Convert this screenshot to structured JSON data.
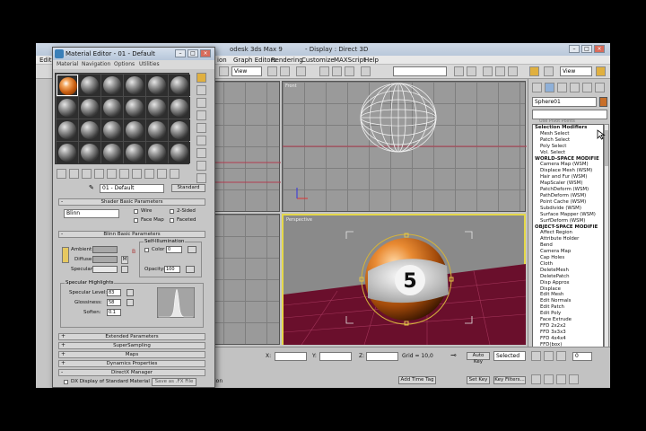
{
  "app": {
    "title_partial": "odesk 3ds Max 9",
    "display_mode": "- Display : Direct 3D"
  },
  "menu": [
    "Edit",
    "ion",
    "Graph Editors",
    "Rendering",
    "Customize",
    "MAXScript",
    "Help"
  ],
  "toolbar": {
    "view_combo": "View",
    "view_combo2": "View"
  },
  "viewports": {
    "front": "Front",
    "perspective": "Perspective",
    "ball_number": "5"
  },
  "command_panel": {
    "object_name": "Sphere01",
    "use_pivot": "Use Pivot Points",
    "modifiers": [
      {
        "t": "Selection Modifiers",
        "h": true
      },
      {
        "t": "Mesh Select"
      },
      {
        "t": "Patch Select"
      },
      {
        "t": "Poly Select"
      },
      {
        "t": "Vol. Select"
      },
      {
        "t": "WORLD-SPACE MODIFIE",
        "h": true
      },
      {
        "t": "Camera Map (WSM)"
      },
      {
        "t": "Displace Mesh (WSM)"
      },
      {
        "t": "Hair and Fur (WSM)"
      },
      {
        "t": "MapScaler (WSM)"
      },
      {
        "t": "PatchDeform (WSM)"
      },
      {
        "t": "PathDeform (WSM)"
      },
      {
        "t": "Point Cache (WSM)"
      },
      {
        "t": "Subdivide (WSM)"
      },
      {
        "t": "Surface Mapper (WSM)"
      },
      {
        "t": "SurfDeform (WSM)"
      },
      {
        "t": "OBJECT-SPACE MODIFIE",
        "h": true
      },
      {
        "t": "Affect Region"
      },
      {
        "t": "Attribute Holder"
      },
      {
        "t": "Bend"
      },
      {
        "t": "Camera Map"
      },
      {
        "t": "Cap Holes"
      },
      {
        "t": "Cloth"
      },
      {
        "t": "DeleteMesh"
      },
      {
        "t": "DeletePatch"
      },
      {
        "t": "Disp Approx"
      },
      {
        "t": "Displace"
      },
      {
        "t": "Edit Mesh"
      },
      {
        "t": "Edit Normals"
      },
      {
        "t": "Edit Patch"
      },
      {
        "t": "Edit Poly"
      },
      {
        "t": "Face Extrude"
      },
      {
        "t": "FFD 2x2x2"
      },
      {
        "t": "FFD 3x3x3"
      },
      {
        "t": "FFD 4x4x4"
      },
      {
        "t": "FFD(box)"
      },
      {
        "t": "FFD(cyl)"
      },
      {
        "t": "Flex"
      },
      {
        "t": "HSDS"
      },
      {
        "t": "Lattice"
      }
    ]
  },
  "bottom": {
    "x_label": "X:",
    "y_label": "Y:",
    "z_label": "Z:",
    "grid": "Grid = 10,0",
    "auto_key": "Auto Key",
    "selected": "Selected",
    "set_key": "Set Key",
    "key_filters": "Key Filters...",
    "add_time_tag": "Add Time Tag",
    "status": "ns the rotation",
    "frame": "0"
  },
  "material_editor": {
    "title": "Material Editor - 01 - Default",
    "menu": [
      "Material",
      "Navigation",
      "Options",
      "Utilities"
    ],
    "material_name": "01 - Default",
    "type_button": "Standard",
    "shader_basic_params": "Shader Basic Parameters",
    "shader": "Blinn",
    "wire": "Wire",
    "two_sided": "2-Sided",
    "face_map": "Face Map",
    "faceted": "Faceted",
    "blinn_basic_params": "Blinn Basic Parameters",
    "self_illum": "Self-Illumination",
    "color": "Color",
    "color_val": "0",
    "ambient": "Ambient:",
    "diffuse": "Diffuse:",
    "specular": "Specular:",
    "opacity": "Opacity:",
    "opacity_val": "100",
    "m_label": "M",
    "spec_highlights": "Specular Highlights",
    "spec_level": "Specular Level:",
    "spec_level_val": "83",
    "glossiness": "Glossiness:",
    "glossiness_val": "58",
    "soften": "Soften:",
    "soften_val": "0.1",
    "rollouts": [
      "Extended Parameters",
      "SuperSampling",
      "Maps",
      "Dynamics Properties",
      "DirectX Manager"
    ],
    "dx_display": "DX Display of Standard Material",
    "save_fx": "Save as .FX File"
  }
}
